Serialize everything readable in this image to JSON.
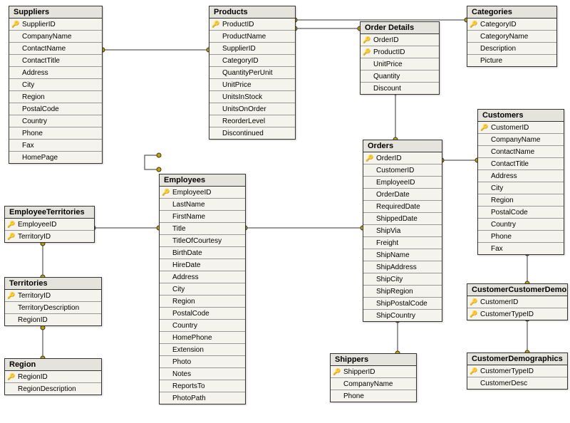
{
  "entities": {
    "suppliers": {
      "title": "Suppliers",
      "columns": [
        "SupplierID",
        "CompanyName",
        "ContactName",
        "ContactTitle",
        "Address",
        "City",
        "Region",
        "PostalCode",
        "Country",
        "Phone",
        "Fax",
        "HomePage"
      ],
      "keys": [
        "SupplierID"
      ]
    },
    "products": {
      "title": "Products",
      "columns": [
        "ProductID",
        "ProductName",
        "SupplierID",
        "CategoryID",
        "QuantityPerUnit",
        "UnitPrice",
        "UnitsInStock",
        "UnitsOnOrder",
        "ReorderLevel",
        "Discontinued"
      ],
      "keys": [
        "ProductID"
      ]
    },
    "categories": {
      "title": "Categories",
      "columns": [
        "CategoryID",
        "CategoryName",
        "Description",
        "Picture"
      ],
      "keys": [
        "CategoryID"
      ]
    },
    "orderDetails": {
      "title": "Order Details",
      "columns": [
        "OrderID",
        "ProductID",
        "UnitPrice",
        "Quantity",
        "Discount"
      ],
      "keys": [
        "OrderID",
        "ProductID"
      ]
    },
    "customers": {
      "title": "Customers",
      "columns": [
        "CustomerID",
        "CompanyName",
        "ContactName",
        "ContactTitle",
        "Address",
        "City",
        "Region",
        "PostalCode",
        "Country",
        "Phone",
        "Fax"
      ],
      "keys": [
        "CustomerID"
      ]
    },
    "orders": {
      "title": "Orders",
      "columns": [
        "OrderID",
        "CustomerID",
        "EmployeeID",
        "OrderDate",
        "RequiredDate",
        "ShippedDate",
        "ShipVia",
        "Freight",
        "ShipName",
        "ShipAddress",
        "ShipCity",
        "ShipRegion",
        "ShipPostalCode",
        "ShipCountry"
      ],
      "keys": [
        "OrderID"
      ]
    },
    "employees": {
      "title": "Employees",
      "columns": [
        "EmployeeID",
        "LastName",
        "FirstName",
        "Title",
        "TitleOfCourtesy",
        "BirthDate",
        "HireDate",
        "Address",
        "City",
        "Region",
        "PostalCode",
        "Country",
        "HomePhone",
        "Extension",
        "Photo",
        "Notes",
        "ReportsTo",
        "PhotoPath"
      ],
      "keys": [
        "EmployeeID"
      ]
    },
    "employeeTerritories": {
      "title": "EmployeeTerritories",
      "columns": [
        "EmployeeID",
        "TerritoryID"
      ],
      "keys": [
        "EmployeeID",
        "TerritoryID"
      ]
    },
    "territories": {
      "title": "Territories",
      "columns": [
        "TerritoryID",
        "TerritoryDescription",
        "RegionID"
      ],
      "keys": [
        "TerritoryID"
      ]
    },
    "region": {
      "title": "Region",
      "columns": [
        "RegionID",
        "RegionDescription"
      ],
      "keys": [
        "RegionID"
      ]
    },
    "shippers": {
      "title": "Shippers",
      "columns": [
        "ShipperID",
        "CompanyName",
        "Phone"
      ],
      "keys": [
        "ShipperID"
      ]
    },
    "customerCustomerDemo": {
      "title": "CustomerCustomerDemo",
      "columns": [
        "CustomerID",
        "CustomerTypeID"
      ],
      "keys": [
        "CustomerID",
        "CustomerTypeID"
      ]
    },
    "customerDemographics": {
      "title": "CustomerDemographics",
      "columns": [
        "CustomerTypeID",
        "CustomerDesc"
      ],
      "keys": [
        "CustomerTypeID"
      ]
    }
  },
  "icons": {
    "key": "🔑"
  }
}
